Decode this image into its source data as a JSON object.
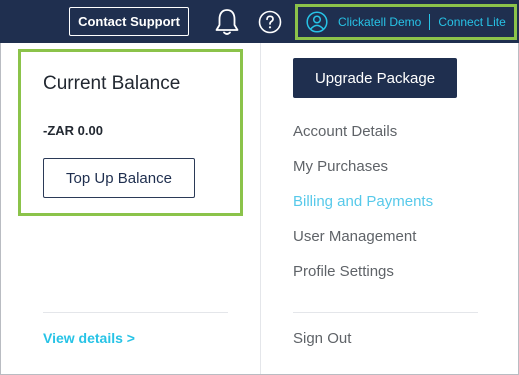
{
  "header": {
    "contact_support": "Contact Support",
    "account_name": "Clickatell Demo",
    "account_plan": "Connect Lite"
  },
  "balance": {
    "title": "Current Balance",
    "amount": "-ZAR 0.00",
    "top_up_label": "Top Up Balance",
    "view_details": "View details >"
  },
  "menu": {
    "upgrade_label": "Upgrade Package",
    "items": [
      {
        "label": "Account Details"
      },
      {
        "label": "My Purchases"
      },
      {
        "label": "Billing and Payments",
        "active": true
      },
      {
        "label": "User Management"
      },
      {
        "label": "Profile Settings"
      }
    ],
    "sign_out": "Sign Out"
  },
  "colors": {
    "navy": "#1f2f4f",
    "accent": "#27c3e6",
    "highlight": "#8bc34a"
  },
  "icons": [
    "bell-icon",
    "help-icon",
    "user-circle-icon"
  ]
}
